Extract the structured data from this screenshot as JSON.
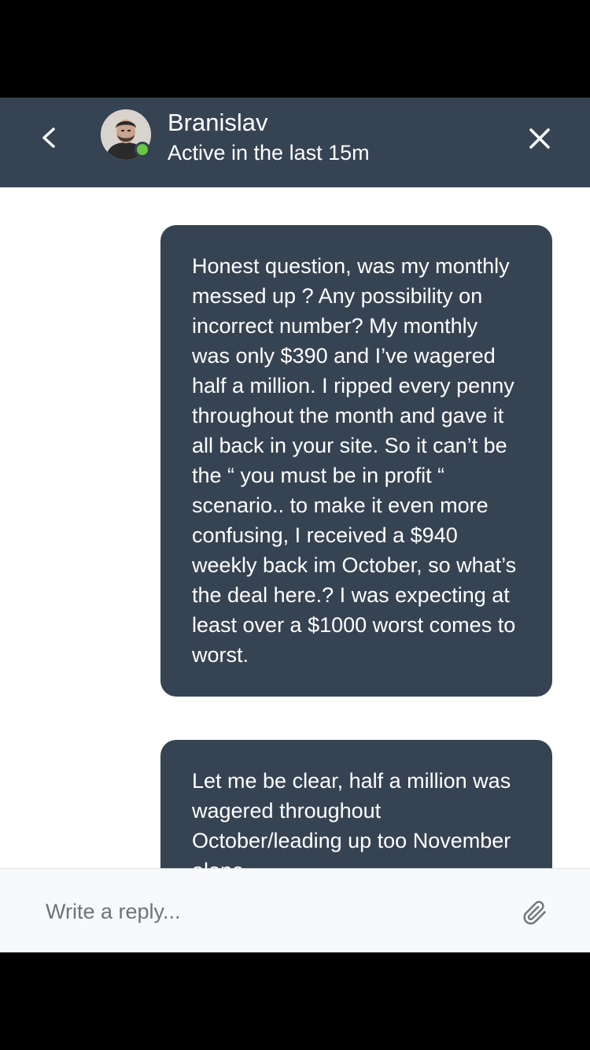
{
  "header": {
    "agent_name": "Branislav",
    "status": "Active in the last 15m",
    "back_icon": "chevron-left-icon",
    "close_icon": "close-icon",
    "background_color": "#364352",
    "presence_color": "#6cc644"
  },
  "messages": [
    {
      "sender": "user",
      "text": "Honest question, was my monthly messed up ? Any possibility on incorrect number? My monthly was only $390 and I’ve wagered half a million. I ripped every penny throughout the month and gave it all back in your site. So it can’t be the “ you must be in profit “ scenario.. to make it even more confusing, I received a $940 weekly back im October, so what’s the deal here.? I was expecting at least over a $1000 worst comes to worst."
    },
    {
      "sender": "user",
      "text": "Let me be clear, half a million was wagered throughout October/leading up too November alone."
    }
  ],
  "composer": {
    "placeholder": "Write a reply...",
    "attach_icon": "paperclip-icon"
  }
}
